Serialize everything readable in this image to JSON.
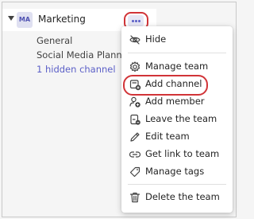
{
  "team": {
    "expand_icon": "caret-down-icon",
    "avatar_initials": "MA",
    "name": "Marketing",
    "more_icon": "more-options-icon"
  },
  "channels": [
    {
      "label": "General"
    },
    {
      "label": "Social Media Planning"
    },
    {
      "label": "1 hidden channel"
    }
  ],
  "menu": {
    "items": [
      {
        "label": "Hide",
        "icon": "eye-off-icon"
      },
      {
        "label": "Manage team",
        "icon": "gear-icon"
      },
      {
        "label": "Add channel",
        "icon": "add-channel-icon"
      },
      {
        "label": "Add member",
        "icon": "add-member-icon"
      },
      {
        "label": "Leave the team",
        "icon": "leave-team-icon"
      },
      {
        "label": "Edit team",
        "icon": "pencil-icon"
      },
      {
        "label": "Get link to team",
        "icon": "link-icon"
      },
      {
        "label": "Manage tags",
        "icon": "tag-icon"
      },
      {
        "label": "Delete the team",
        "icon": "trash-icon"
      }
    ]
  },
  "colors": {
    "accent": "#5b5fc7",
    "highlight": "#d13438",
    "avatar_bg": "#dfe0f1"
  }
}
